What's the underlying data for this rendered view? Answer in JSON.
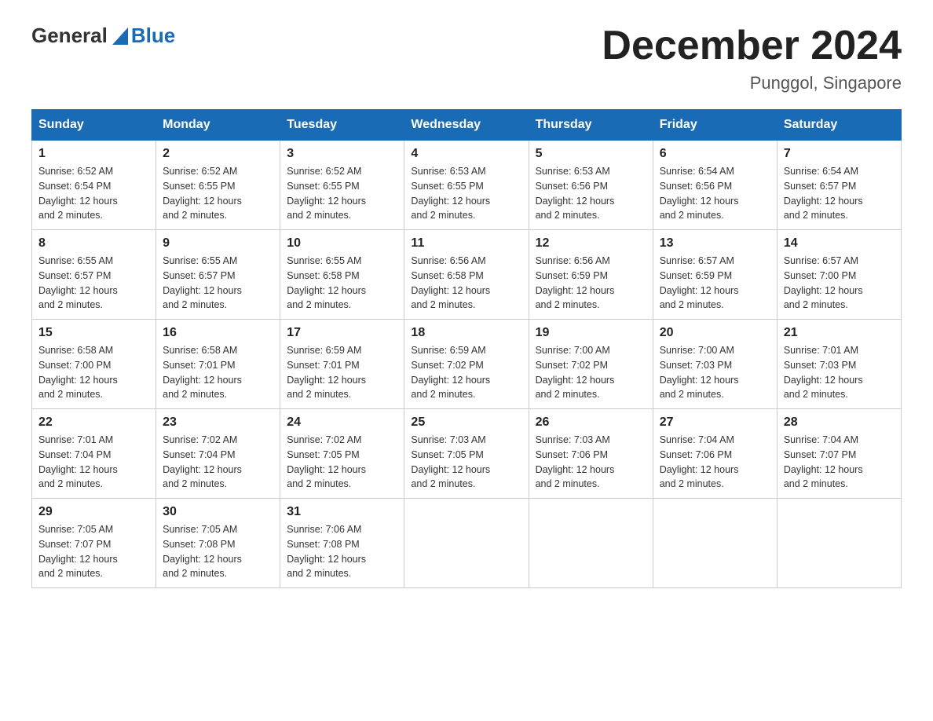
{
  "logo": {
    "text_general": "General",
    "text_blue": "Blue"
  },
  "title": "December 2024",
  "subtitle": "Punggol, Singapore",
  "days_of_week": [
    "Sunday",
    "Monday",
    "Tuesday",
    "Wednesday",
    "Thursday",
    "Friday",
    "Saturday"
  ],
  "weeks": [
    [
      {
        "day": "1",
        "sunrise": "6:52 AM",
        "sunset": "6:54 PM",
        "daylight": "12 hours and 2 minutes."
      },
      {
        "day": "2",
        "sunrise": "6:52 AM",
        "sunset": "6:55 PM",
        "daylight": "12 hours and 2 minutes."
      },
      {
        "day": "3",
        "sunrise": "6:52 AM",
        "sunset": "6:55 PM",
        "daylight": "12 hours and 2 minutes."
      },
      {
        "day": "4",
        "sunrise": "6:53 AM",
        "sunset": "6:55 PM",
        "daylight": "12 hours and 2 minutes."
      },
      {
        "day": "5",
        "sunrise": "6:53 AM",
        "sunset": "6:56 PM",
        "daylight": "12 hours and 2 minutes."
      },
      {
        "day": "6",
        "sunrise": "6:54 AM",
        "sunset": "6:56 PM",
        "daylight": "12 hours and 2 minutes."
      },
      {
        "day": "7",
        "sunrise": "6:54 AM",
        "sunset": "6:57 PM",
        "daylight": "12 hours and 2 minutes."
      }
    ],
    [
      {
        "day": "8",
        "sunrise": "6:55 AM",
        "sunset": "6:57 PM",
        "daylight": "12 hours and 2 minutes."
      },
      {
        "day": "9",
        "sunrise": "6:55 AM",
        "sunset": "6:57 PM",
        "daylight": "12 hours and 2 minutes."
      },
      {
        "day": "10",
        "sunrise": "6:55 AM",
        "sunset": "6:58 PM",
        "daylight": "12 hours and 2 minutes."
      },
      {
        "day": "11",
        "sunrise": "6:56 AM",
        "sunset": "6:58 PM",
        "daylight": "12 hours and 2 minutes."
      },
      {
        "day": "12",
        "sunrise": "6:56 AM",
        "sunset": "6:59 PM",
        "daylight": "12 hours and 2 minutes."
      },
      {
        "day": "13",
        "sunrise": "6:57 AM",
        "sunset": "6:59 PM",
        "daylight": "12 hours and 2 minutes."
      },
      {
        "day": "14",
        "sunrise": "6:57 AM",
        "sunset": "7:00 PM",
        "daylight": "12 hours and 2 minutes."
      }
    ],
    [
      {
        "day": "15",
        "sunrise": "6:58 AM",
        "sunset": "7:00 PM",
        "daylight": "12 hours and 2 minutes."
      },
      {
        "day": "16",
        "sunrise": "6:58 AM",
        "sunset": "7:01 PM",
        "daylight": "12 hours and 2 minutes."
      },
      {
        "day": "17",
        "sunrise": "6:59 AM",
        "sunset": "7:01 PM",
        "daylight": "12 hours and 2 minutes."
      },
      {
        "day": "18",
        "sunrise": "6:59 AM",
        "sunset": "7:02 PM",
        "daylight": "12 hours and 2 minutes."
      },
      {
        "day": "19",
        "sunrise": "7:00 AM",
        "sunset": "7:02 PM",
        "daylight": "12 hours and 2 minutes."
      },
      {
        "day": "20",
        "sunrise": "7:00 AM",
        "sunset": "7:03 PM",
        "daylight": "12 hours and 2 minutes."
      },
      {
        "day": "21",
        "sunrise": "7:01 AM",
        "sunset": "7:03 PM",
        "daylight": "12 hours and 2 minutes."
      }
    ],
    [
      {
        "day": "22",
        "sunrise": "7:01 AM",
        "sunset": "7:04 PM",
        "daylight": "12 hours and 2 minutes."
      },
      {
        "day": "23",
        "sunrise": "7:02 AM",
        "sunset": "7:04 PM",
        "daylight": "12 hours and 2 minutes."
      },
      {
        "day": "24",
        "sunrise": "7:02 AM",
        "sunset": "7:05 PM",
        "daylight": "12 hours and 2 minutes."
      },
      {
        "day": "25",
        "sunrise": "7:03 AM",
        "sunset": "7:05 PM",
        "daylight": "12 hours and 2 minutes."
      },
      {
        "day": "26",
        "sunrise": "7:03 AM",
        "sunset": "7:06 PM",
        "daylight": "12 hours and 2 minutes."
      },
      {
        "day": "27",
        "sunrise": "7:04 AM",
        "sunset": "7:06 PM",
        "daylight": "12 hours and 2 minutes."
      },
      {
        "day": "28",
        "sunrise": "7:04 AM",
        "sunset": "7:07 PM",
        "daylight": "12 hours and 2 minutes."
      }
    ],
    [
      {
        "day": "29",
        "sunrise": "7:05 AM",
        "sunset": "7:07 PM",
        "daylight": "12 hours and 2 minutes."
      },
      {
        "day": "30",
        "sunrise": "7:05 AM",
        "sunset": "7:08 PM",
        "daylight": "12 hours and 2 minutes."
      },
      {
        "day": "31",
        "sunrise": "7:06 AM",
        "sunset": "7:08 PM",
        "daylight": "12 hours and 2 minutes."
      },
      null,
      null,
      null,
      null
    ]
  ],
  "labels": {
    "sunrise": "Sunrise:",
    "sunset": "Sunset:",
    "daylight": "Daylight:"
  }
}
